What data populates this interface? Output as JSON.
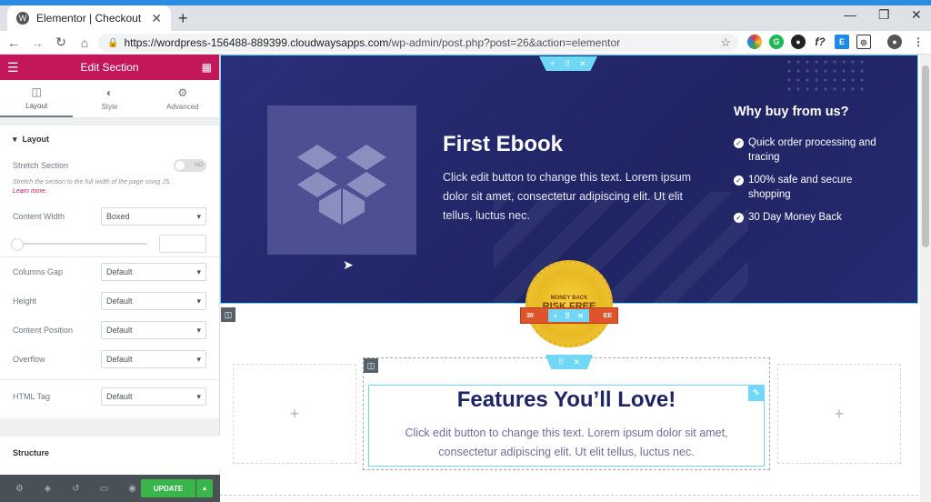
{
  "browser": {
    "tab_title": "Elementor | Checkout Page",
    "url_host": "https://wordpress-156488-889399.cloudwaysapps.com",
    "url_path": "/wp-admin/post.php?post=26&action=elementor"
  },
  "panel": {
    "header_title": "Edit Section",
    "tabs": [
      {
        "label": "Layout"
      },
      {
        "label": "Style"
      },
      {
        "label": "Advanced"
      }
    ],
    "layout_title": "Layout",
    "stretch_label": "Stretch Section",
    "stretch_toggle": "NO",
    "stretch_hint": "Stretch the section to the full width of the page using JS.",
    "learn_more": "Learn more.",
    "content_width_label": "Content Width",
    "content_width_value": "Boxed",
    "columns_gap_label": "Columns Gap",
    "columns_gap_value": "Default",
    "height_label": "Height",
    "height_value": "Default",
    "content_position_label": "Content Position",
    "content_position_value": "Default",
    "overflow_label": "Overflow",
    "overflow_value": "Default",
    "html_tag_label": "HTML Tag",
    "html_tag_value": "Default",
    "structure_title": "Structure",
    "update_label": "UPDATE"
  },
  "hero": {
    "title": "First Ebook",
    "text": "Click edit button to change this text. Lorem ipsum dolor sit amet, consectetur adipiscing elit. Ut elit tellus, luctus nec.",
    "why_title": "Why buy from us?",
    "why_items": [
      "Quick order processing and tracing",
      "100% safe and secure shopping",
      "30 Day Money Back"
    ]
  },
  "badge": {
    "top": "MONEY BACK",
    "main": "RISK FREE",
    "ribbon_left": "30",
    "ribbon_right": "EE"
  },
  "features": {
    "title": "Features You’ll Love!",
    "text": "Click edit button to change this text. Lorem ipsum dolor sit amet, consectetur adipiscing elit. Ut elit tellus, luctus nec."
  },
  "colors": {
    "elementor_pink": "#c3175b",
    "hero_bg": "#1f2463",
    "editor_cyan": "#71d7f7",
    "update_green": "#39b54a"
  }
}
